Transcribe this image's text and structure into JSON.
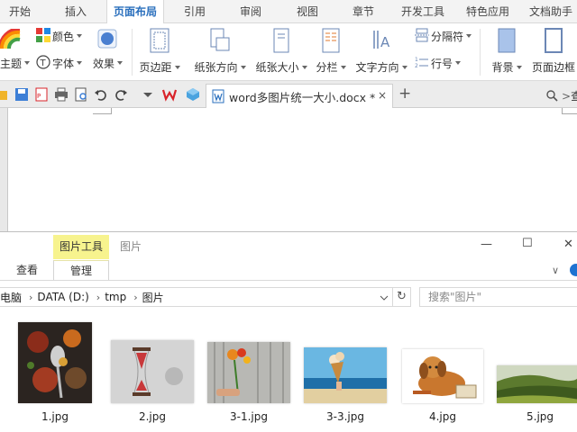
{
  "menu_tabs": [
    {
      "label": "开始",
      "active": false
    },
    {
      "label": "插入",
      "active": false
    },
    {
      "label": "页面布局",
      "active": true
    },
    {
      "label": "引用",
      "active": false
    },
    {
      "label": "审阅",
      "active": false
    },
    {
      "label": "视图",
      "active": false
    },
    {
      "label": "章节",
      "active": false
    },
    {
      "label": "开发工具",
      "active": false
    },
    {
      "label": "特色应用",
      "active": false
    },
    {
      "label": "文档助手",
      "active": false
    }
  ],
  "ribbon": {
    "theme": "主题",
    "colors": "颜色",
    "font": "字体",
    "effects": "效果",
    "margins": "页边距",
    "orientation": "纸张方向",
    "size": "纸张大小",
    "columns": "分栏",
    "text_direction": "文字方向",
    "breaks": "分隔符",
    "line_numbers": "行号",
    "background": "背景",
    "page_border": "页面边框"
  },
  "doc_tab": {
    "filename": "word多图片统一大小.docx *",
    "close": "×"
  },
  "quick_search_label": "查",
  "explorer": {
    "context_tab": "图片工具",
    "title": "图片",
    "tab_view": "查看",
    "tab_manage": "管理",
    "address": [
      "电脑",
      "DATA (D:)",
      "tmp",
      "图片"
    ],
    "search_placeholder": "搜索\"图片\"",
    "files": [
      "1.jpg",
      "2.jpg",
      "3-1.jpg",
      "3-3.jpg",
      "4.jpg",
      "5.jpg"
    ]
  },
  "colors": {
    "accent_blue": "#2a6fbd",
    "context_yellow": "#f7f38e",
    "wps_red": "#d9232a"
  }
}
